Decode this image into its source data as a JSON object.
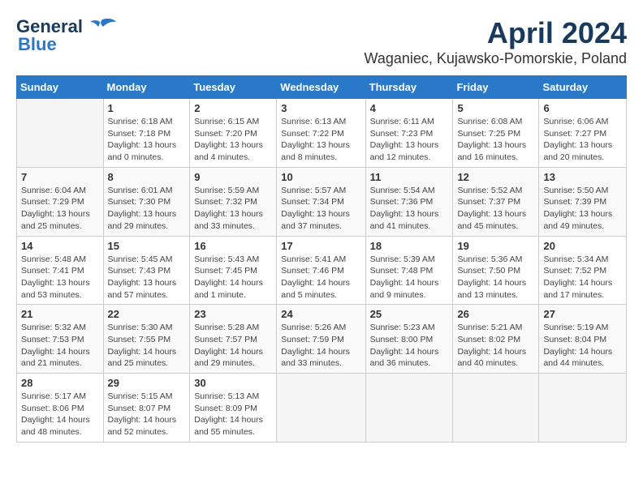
{
  "logo": {
    "line1": "General",
    "line2": "Blue"
  },
  "title": "April 2024",
  "subtitle": "Waganiec, Kujawsko-Pomorskie, Poland",
  "days_of_week": [
    "Sunday",
    "Monday",
    "Tuesday",
    "Wednesday",
    "Thursday",
    "Friday",
    "Saturday"
  ],
  "weeks": [
    [
      {
        "day": "",
        "sunrise": "",
        "sunset": "",
        "daylight": ""
      },
      {
        "day": "1",
        "sunrise": "Sunrise: 6:18 AM",
        "sunset": "Sunset: 7:18 PM",
        "daylight": "Daylight: 13 hours and 0 minutes."
      },
      {
        "day": "2",
        "sunrise": "Sunrise: 6:15 AM",
        "sunset": "Sunset: 7:20 PM",
        "daylight": "Daylight: 13 hours and 4 minutes."
      },
      {
        "day": "3",
        "sunrise": "Sunrise: 6:13 AM",
        "sunset": "Sunset: 7:22 PM",
        "daylight": "Daylight: 13 hours and 8 minutes."
      },
      {
        "day": "4",
        "sunrise": "Sunrise: 6:11 AM",
        "sunset": "Sunset: 7:23 PM",
        "daylight": "Daylight: 13 hours and 12 minutes."
      },
      {
        "day": "5",
        "sunrise": "Sunrise: 6:08 AM",
        "sunset": "Sunset: 7:25 PM",
        "daylight": "Daylight: 13 hours and 16 minutes."
      },
      {
        "day": "6",
        "sunrise": "Sunrise: 6:06 AM",
        "sunset": "Sunset: 7:27 PM",
        "daylight": "Daylight: 13 hours and 20 minutes."
      }
    ],
    [
      {
        "day": "7",
        "sunrise": "Sunrise: 6:04 AM",
        "sunset": "Sunset: 7:29 PM",
        "daylight": "Daylight: 13 hours and 25 minutes."
      },
      {
        "day": "8",
        "sunrise": "Sunrise: 6:01 AM",
        "sunset": "Sunset: 7:30 PM",
        "daylight": "Daylight: 13 hours and 29 minutes."
      },
      {
        "day": "9",
        "sunrise": "Sunrise: 5:59 AM",
        "sunset": "Sunset: 7:32 PM",
        "daylight": "Daylight: 13 hours and 33 minutes."
      },
      {
        "day": "10",
        "sunrise": "Sunrise: 5:57 AM",
        "sunset": "Sunset: 7:34 PM",
        "daylight": "Daylight: 13 hours and 37 minutes."
      },
      {
        "day": "11",
        "sunrise": "Sunrise: 5:54 AM",
        "sunset": "Sunset: 7:36 PM",
        "daylight": "Daylight: 13 hours and 41 minutes."
      },
      {
        "day": "12",
        "sunrise": "Sunrise: 5:52 AM",
        "sunset": "Sunset: 7:37 PM",
        "daylight": "Daylight: 13 hours and 45 minutes."
      },
      {
        "day": "13",
        "sunrise": "Sunrise: 5:50 AM",
        "sunset": "Sunset: 7:39 PM",
        "daylight": "Daylight: 13 hours and 49 minutes."
      }
    ],
    [
      {
        "day": "14",
        "sunrise": "Sunrise: 5:48 AM",
        "sunset": "Sunset: 7:41 PM",
        "daylight": "Daylight: 13 hours and 53 minutes."
      },
      {
        "day": "15",
        "sunrise": "Sunrise: 5:45 AM",
        "sunset": "Sunset: 7:43 PM",
        "daylight": "Daylight: 13 hours and 57 minutes."
      },
      {
        "day": "16",
        "sunrise": "Sunrise: 5:43 AM",
        "sunset": "Sunset: 7:45 PM",
        "daylight": "Daylight: 14 hours and 1 minute."
      },
      {
        "day": "17",
        "sunrise": "Sunrise: 5:41 AM",
        "sunset": "Sunset: 7:46 PM",
        "daylight": "Daylight: 14 hours and 5 minutes."
      },
      {
        "day": "18",
        "sunrise": "Sunrise: 5:39 AM",
        "sunset": "Sunset: 7:48 PM",
        "daylight": "Daylight: 14 hours and 9 minutes."
      },
      {
        "day": "19",
        "sunrise": "Sunrise: 5:36 AM",
        "sunset": "Sunset: 7:50 PM",
        "daylight": "Daylight: 14 hours and 13 minutes."
      },
      {
        "day": "20",
        "sunrise": "Sunrise: 5:34 AM",
        "sunset": "Sunset: 7:52 PM",
        "daylight": "Daylight: 14 hours and 17 minutes."
      }
    ],
    [
      {
        "day": "21",
        "sunrise": "Sunrise: 5:32 AM",
        "sunset": "Sunset: 7:53 PM",
        "daylight": "Daylight: 14 hours and 21 minutes."
      },
      {
        "day": "22",
        "sunrise": "Sunrise: 5:30 AM",
        "sunset": "Sunset: 7:55 PM",
        "daylight": "Daylight: 14 hours and 25 minutes."
      },
      {
        "day": "23",
        "sunrise": "Sunrise: 5:28 AM",
        "sunset": "Sunset: 7:57 PM",
        "daylight": "Daylight: 14 hours and 29 minutes."
      },
      {
        "day": "24",
        "sunrise": "Sunrise: 5:26 AM",
        "sunset": "Sunset: 7:59 PM",
        "daylight": "Daylight: 14 hours and 33 minutes."
      },
      {
        "day": "25",
        "sunrise": "Sunrise: 5:23 AM",
        "sunset": "Sunset: 8:00 PM",
        "daylight": "Daylight: 14 hours and 36 minutes."
      },
      {
        "day": "26",
        "sunrise": "Sunrise: 5:21 AM",
        "sunset": "Sunset: 8:02 PM",
        "daylight": "Daylight: 14 hours and 40 minutes."
      },
      {
        "day": "27",
        "sunrise": "Sunrise: 5:19 AM",
        "sunset": "Sunset: 8:04 PM",
        "daylight": "Daylight: 14 hours and 44 minutes."
      }
    ],
    [
      {
        "day": "28",
        "sunrise": "Sunrise: 5:17 AM",
        "sunset": "Sunset: 8:06 PM",
        "daylight": "Daylight: 14 hours and 48 minutes."
      },
      {
        "day": "29",
        "sunrise": "Sunrise: 5:15 AM",
        "sunset": "Sunset: 8:07 PM",
        "daylight": "Daylight: 14 hours and 52 minutes."
      },
      {
        "day": "30",
        "sunrise": "Sunrise: 5:13 AM",
        "sunset": "Sunset: 8:09 PM",
        "daylight": "Daylight: 14 hours and 55 minutes."
      },
      {
        "day": "",
        "sunrise": "",
        "sunset": "",
        "daylight": ""
      },
      {
        "day": "",
        "sunrise": "",
        "sunset": "",
        "daylight": ""
      },
      {
        "day": "",
        "sunrise": "",
        "sunset": "",
        "daylight": ""
      },
      {
        "day": "",
        "sunrise": "",
        "sunset": "",
        "daylight": ""
      }
    ]
  ]
}
